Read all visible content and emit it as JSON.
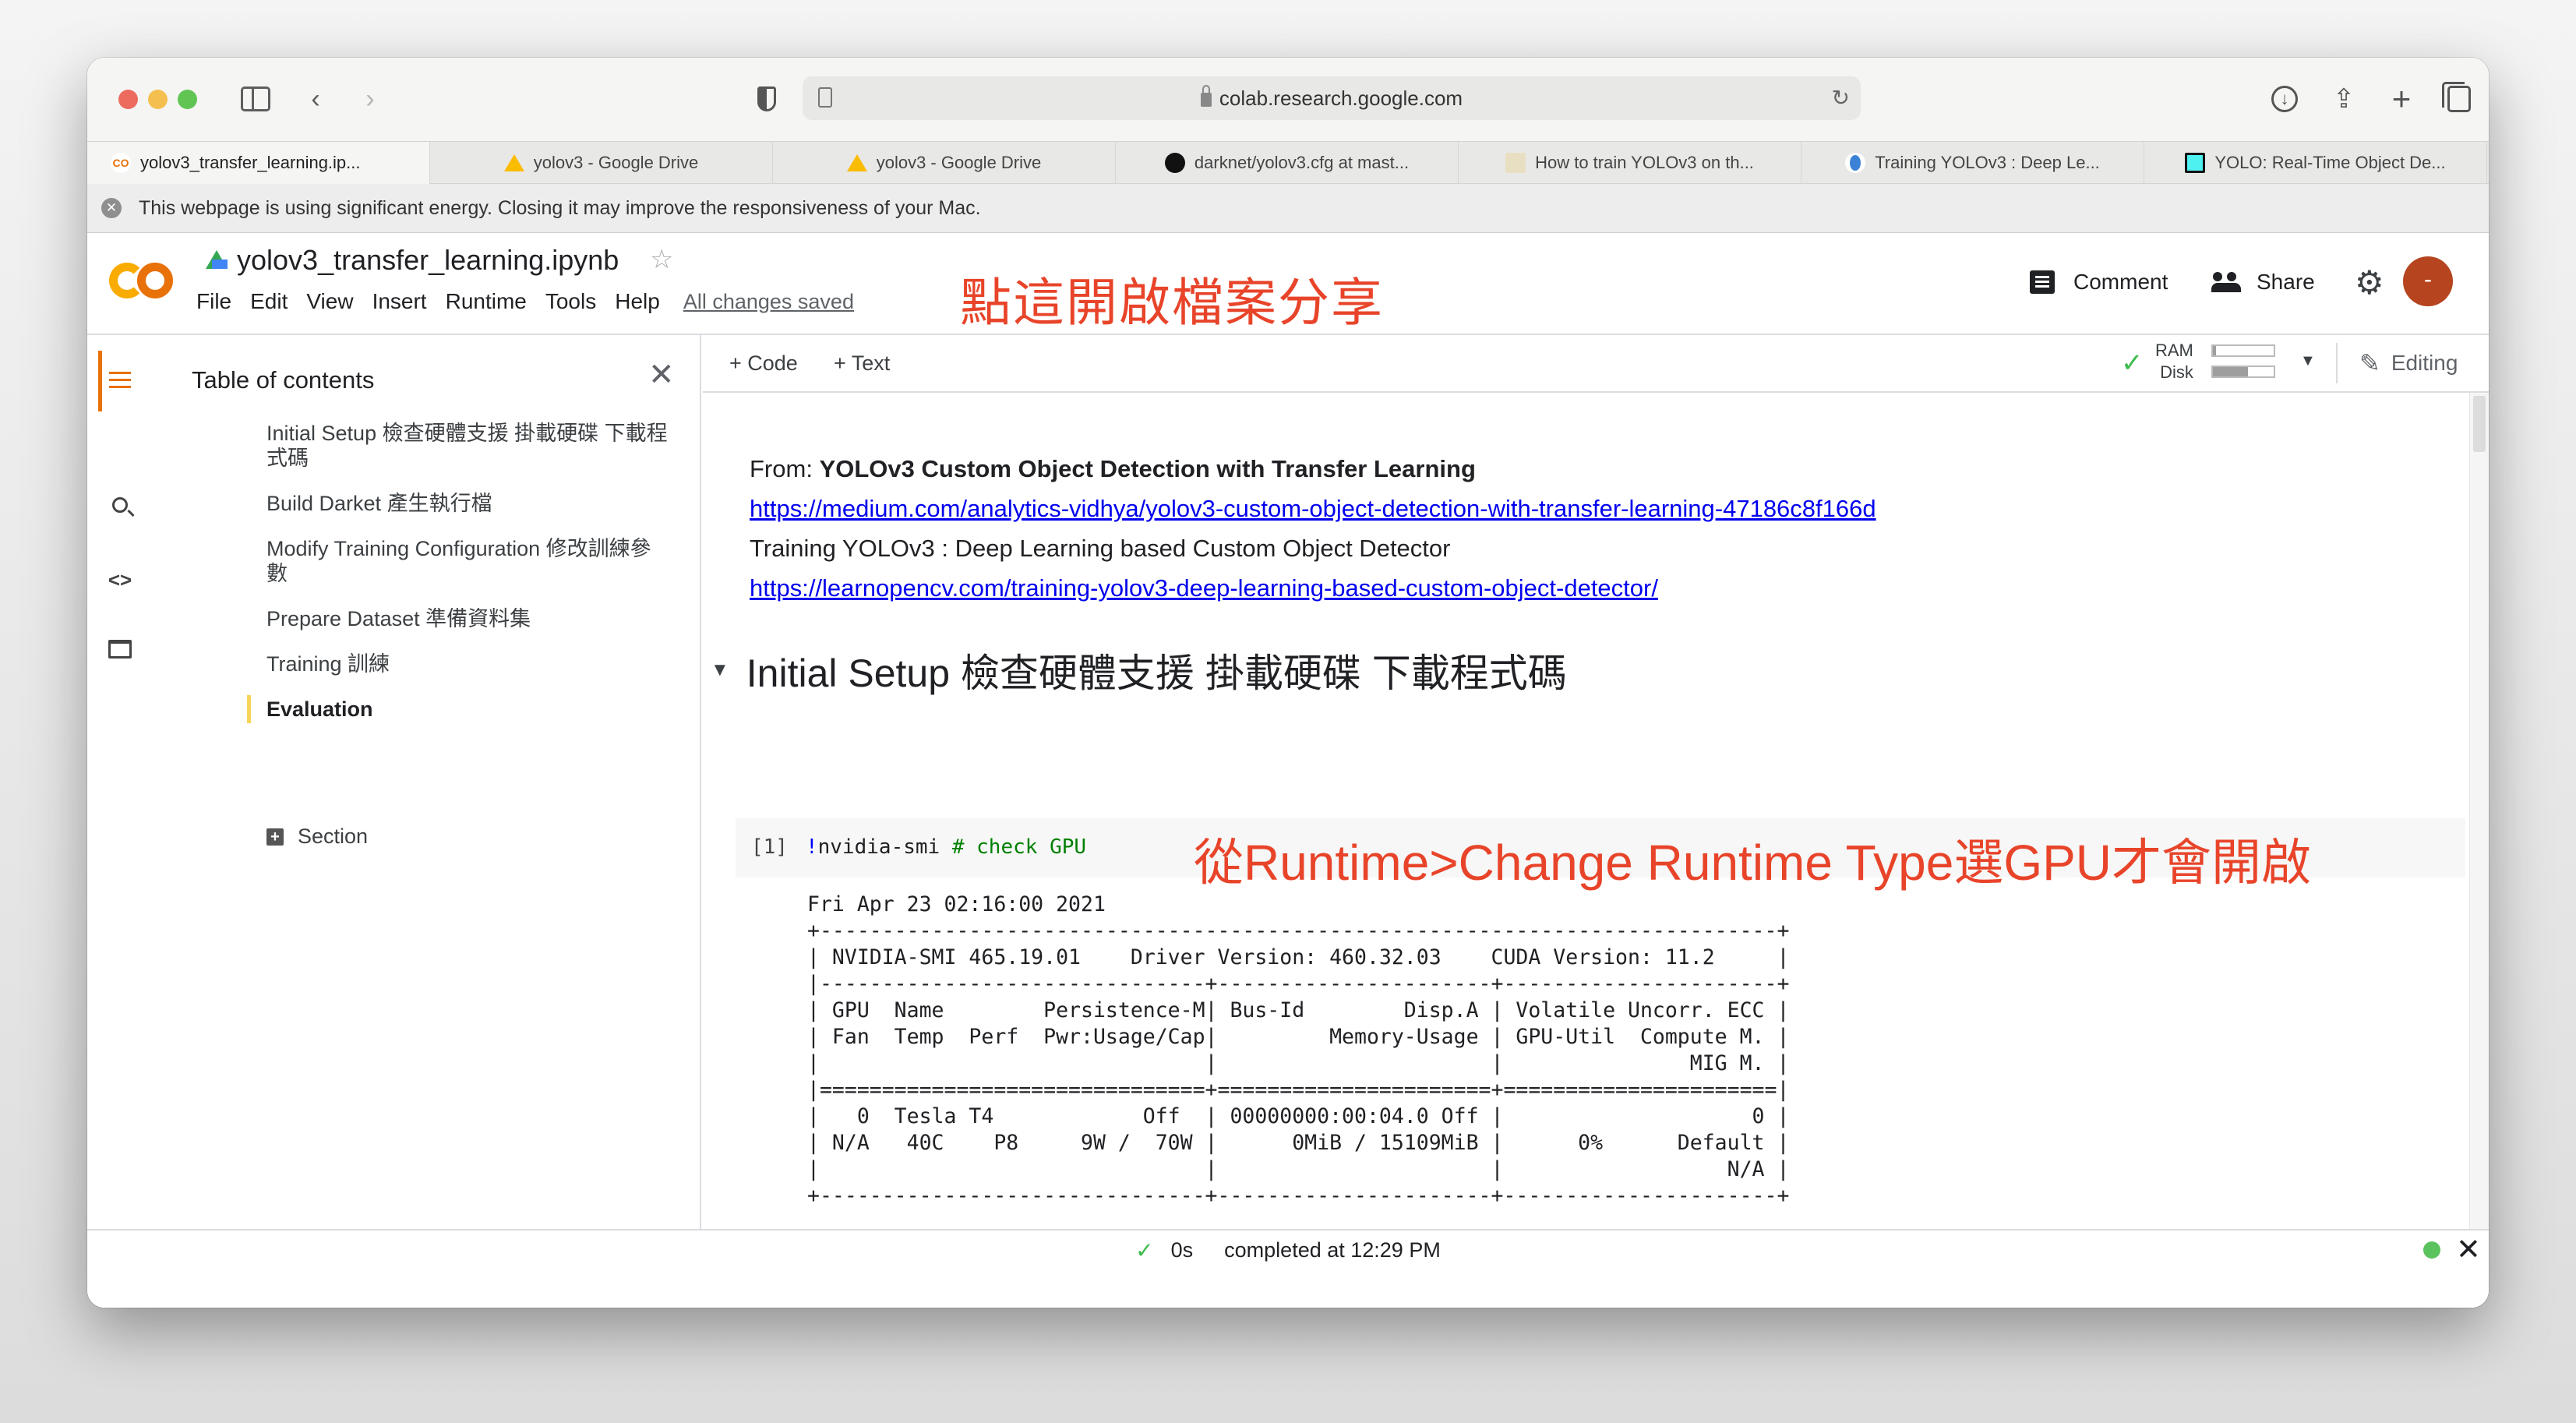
{
  "browser": {
    "url": "colab.research.google.com",
    "tabs": [
      {
        "label": "yolov3_transfer_learning.ip...",
        "icon": "colab-icon",
        "active": true
      },
      {
        "label": "yolov3 - Google Drive",
        "icon": "google-drive-icon",
        "active": false
      },
      {
        "label": "yolov3 - Google Drive",
        "icon": "google-drive-icon",
        "active": false
      },
      {
        "label": "darknet/yolov3.cfg at mast...",
        "icon": "github-icon",
        "active": false
      },
      {
        "label": "How to train YOLOv3 on th...",
        "icon": "article-icon",
        "active": false
      },
      {
        "label": "Training YOLOv3 : Deep Le...",
        "icon": "learnopencv-icon",
        "active": false
      },
      {
        "label": "YOLO: Real-Time Object De...",
        "icon": "yolo-icon",
        "active": false
      }
    ],
    "energy_banner": "This webpage is using significant energy. Closing it may improve the responsiveness of your Mac."
  },
  "colab": {
    "logo": "CO",
    "notebook_title": "yolov3_transfer_learning.ipynb",
    "menu": [
      "File",
      "Edit",
      "View",
      "Insert",
      "Runtime",
      "Tools",
      "Help"
    ],
    "save_status": "All changes saved",
    "annotation_share": "點這開啟檔案分享",
    "comment_label": "Comment",
    "share_label": "Share",
    "avatar_initial": "-",
    "colors": {
      "accent": "#e8710a",
      "annotation": "#e8442a",
      "avatar": "#b5441f",
      "ok": "#3dbb4d"
    }
  },
  "toolbar": {
    "add_code": "+ Code",
    "add_text": "+ Text",
    "ram_label": "RAM",
    "disk_label": "Disk",
    "ram_usage_fraction": 0.05,
    "disk_usage_fraction": 0.58,
    "mode_label": "Editing"
  },
  "toc": {
    "title": "Table of contents",
    "items": [
      {
        "label": "Initial Setup 檢查硬體支援 掛載硬碟 下載程式碼",
        "active": false
      },
      {
        "label": "Build Darket 產生執行檔",
        "active": false
      },
      {
        "label": "Modify Training Configuration 修改訓練參數",
        "active": false
      },
      {
        "label": "Prepare Dataset 準備資料集",
        "active": false
      },
      {
        "label": "Training 訓練",
        "active": false
      },
      {
        "label": "Evaluation",
        "active": true
      }
    ],
    "add_section": "Section"
  },
  "notebook": {
    "intro": {
      "from_label": "From: ",
      "from_title": "YOLOv3 Custom Object Detection with Transfer Learning",
      "link1": "https://medium.com/analytics-vidhya/yolov3-custom-object-detection-with-transfer-learning-47186c8f166d",
      "line3": "Training YOLOv3 : Deep Learning based Custom Object Detector",
      "link2": "https://learnopencv.com/training-yolov3-deep-learning-based-custom-object-detector/"
    },
    "section_heading": "Initial Setup 檢查硬體支援 掛載硬碟 下載程式碼",
    "code_cell": {
      "exec_count": "[1]",
      "bang": "!",
      "command": "nvidia-smi ",
      "comment": "# check GPU",
      "annotation": "從Runtime>Change Runtime Type選GPU才會開啟"
    },
    "output": "Fri Apr 23 02:16:00 2021       \n+-----------------------------------------------------------------------------+\n| NVIDIA-SMI 465.19.01    Driver Version: 460.32.03    CUDA Version: 11.2     |\n|-------------------------------+----------------------+----------------------+\n| GPU  Name        Persistence-M| Bus-Id        Disp.A | Volatile Uncorr. ECC |\n| Fan  Temp  Perf  Pwr:Usage/Cap|         Memory-Usage | GPU-Util  Compute M. |\n|                               |                      |               MIG M. |\n|===============================+======================+======================|\n|   0  Tesla T4            Off  | 00000000:00:04.0 Off |                    0 |\n| N/A   40C    P8     9W /  70W |      0MiB / 15109MiB |      0%      Default |\n|                               |                      |                  N/A |\n+-------------------------------+----------------------+----------------------+\n                                                                               \n+-----------------------------------------------------------------------------+\n| Processes:                                                                  |\n|  GPU   GI   CI        PID   Type   Process name                  GPU Memory |\n|        ID   ID                                                   Usage      |"
  },
  "status": {
    "duration": "0s",
    "completed": "completed at 12:29 PM"
  }
}
